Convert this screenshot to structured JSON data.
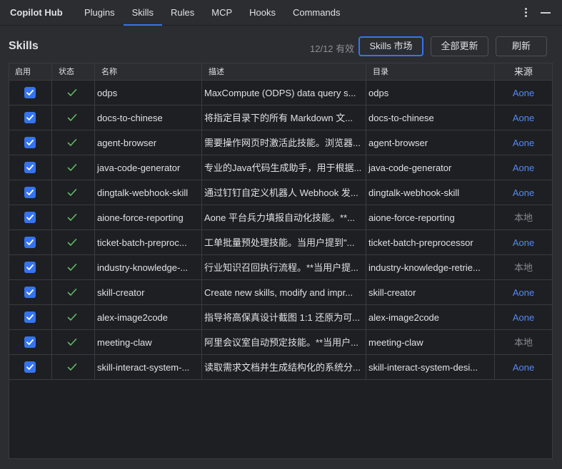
{
  "app": {
    "title": "Copilot Hub"
  },
  "tabs": [
    {
      "label": "Plugins",
      "active": false
    },
    {
      "label": "Skills",
      "active": true
    },
    {
      "label": "Rules",
      "active": false
    },
    {
      "label": "MCP",
      "active": false
    },
    {
      "label": "Hooks",
      "active": false
    },
    {
      "label": "Commands",
      "active": false
    }
  ],
  "header": {
    "title": "Skills",
    "count": "12/12 有效",
    "market_button": "Skills 市场",
    "update_all_button": "全部更新",
    "refresh_button": "刷新"
  },
  "table": {
    "columns": {
      "enabled": "启用",
      "status": "状态",
      "name": "名称",
      "description": "描述",
      "directory": "目录",
      "source": "来源"
    },
    "rows": [
      {
        "enabled": true,
        "status": "ok",
        "name": "odps",
        "description": "MaxCompute (ODPS) data query s...",
        "directory": "odps",
        "source": "Aone",
        "source_type": "remote"
      },
      {
        "enabled": true,
        "status": "ok",
        "name": "docs-to-chinese",
        "description": "将指定目录下的所有 Markdown 文...",
        "directory": "docs-to-chinese",
        "source": "Aone",
        "source_type": "remote"
      },
      {
        "enabled": true,
        "status": "ok",
        "name": "agent-browser",
        "description": "需要操作网页时激活此技能。浏览器...",
        "directory": "agent-browser",
        "source": "Aone",
        "source_type": "remote"
      },
      {
        "enabled": true,
        "status": "ok",
        "name": "java-code-generator",
        "description": "专业的Java代码生成助手，用于根据...",
        "directory": "java-code-generator",
        "source": "Aone",
        "source_type": "remote"
      },
      {
        "enabled": true,
        "status": "ok",
        "name": "dingtalk-webhook-skill",
        "description": "通过钉钉自定义机器人 Webhook 发...",
        "directory": "dingtalk-webhook-skill",
        "source": "Aone",
        "source_type": "remote"
      },
      {
        "enabled": true,
        "status": "ok",
        "name": "aione-force-reporting",
        "description": "Aone 平台兵力填报自动化技能。**...",
        "directory": "aione-force-reporting",
        "source": "本地",
        "source_type": "local"
      },
      {
        "enabled": true,
        "status": "ok",
        "name": "ticket-batch-preproc...",
        "description": "工单批量预处理技能。当用户提到\"...",
        "directory": "ticket-batch-preprocessor",
        "source": "Aone",
        "source_type": "remote"
      },
      {
        "enabled": true,
        "status": "ok",
        "name": "industry-knowledge-...",
        "description": "行业知识召回执行流程。**当用户提...",
        "directory": "industry-knowledge-retrie...",
        "source": "本地",
        "source_type": "local"
      },
      {
        "enabled": true,
        "status": "ok",
        "name": "skill-creator",
        "description": "Create new skills, modify and impr...",
        "directory": "skill-creator",
        "source": "Aone",
        "source_type": "remote"
      },
      {
        "enabled": true,
        "status": "ok",
        "name": "alex-image2code",
        "description": "指导将高保真设计截图 1:1 还原为可...",
        "directory": "alex-image2code",
        "source": "Aone",
        "source_type": "remote"
      },
      {
        "enabled": true,
        "status": "ok",
        "name": "meeting-claw",
        "description": "阿里会议室自动预定技能。**当用户...",
        "directory": "meeting-claw",
        "source": "本地",
        "source_type": "local"
      },
      {
        "enabled": true,
        "status": "ok",
        "name": "skill-interact-system-...",
        "description": "读取需求文档并生成结构化的系统分...",
        "directory": "skill-interact-system-desi...",
        "source": "Aone",
        "source_type": "remote"
      }
    ]
  },
  "colors": {
    "accent": "#3574f0",
    "link": "#548af7",
    "check_green": "#5fb865",
    "muted": "#868a91"
  },
  "icons": {
    "enabled": "checkbox-checked-icon",
    "status_ok": "checkmark-icon",
    "menu": "kebab-menu-icon",
    "minimize": "minimize-icon"
  }
}
